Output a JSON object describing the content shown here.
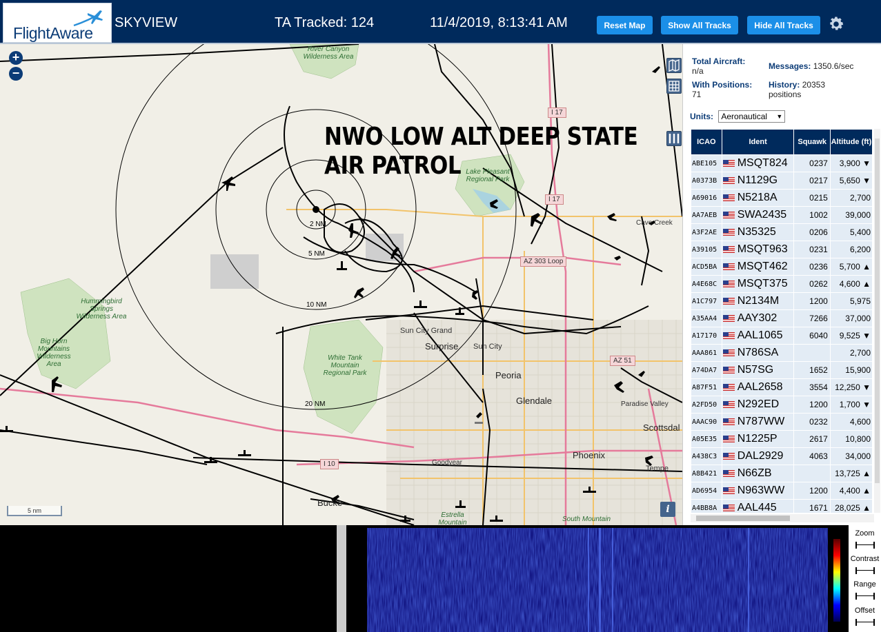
{
  "header": {
    "logo": "FlightAware",
    "app_name": "SKYVIEW",
    "tracked_label": "TA Tracked: 124",
    "datetime": "11/4/2019, 8:13:41 AM",
    "buttons": {
      "reset_map": "Reset Map",
      "show_all_tracks": "Show All Tracks",
      "hide_all_tracks": "Hide All Tracks"
    },
    "settings_icon": "gear-icon"
  },
  "map": {
    "caption_line1": "NWO LOW ALT DEEP STATE",
    "caption_line2": "AIR PATROL",
    "zoom_in": "+",
    "zoom_out": "−",
    "scale_label": "5 nm",
    "info_label": "i",
    "ring_labels": [
      "2 NM",
      "5 NM",
      "10 NM",
      "20 NM"
    ],
    "places": {
      "river_canyon": "River Canyon Wilderness Area",
      "lake_pleasant": "Lake Pleasant Regional Park",
      "hummingbird": "Hummingbird Springs Wilderness Area",
      "big_horn": "Big Horn Mountains Wilderness Area",
      "white_tank": "White Tank Mountain Regional Park",
      "sun_city_grand": "Sun City Grand",
      "surprise": "Surprise",
      "sun_city": "Sun City",
      "peoria": "Peoria",
      "glendale": "Glendale",
      "phoenix": "Phoenix",
      "paradise_valley": "Paradise Valley",
      "scottsdale": "Scottsdal",
      "tempe": "Tempe",
      "goodyear": "Goodyear",
      "buckeye": "Bucke",
      "cave_creek": "Cave Creek",
      "south_mountain": "South Mountain",
      "estrella": "Estrella Mountain"
    },
    "highways": [
      "I 17",
      "I 17",
      "AZ 303 Loop",
      "AZ 51",
      "I 10"
    ]
  },
  "panel": {
    "total_aircraft_label": "Total Aircraft:",
    "total_aircraft_value": "n/a",
    "with_positions_label": "With Positions:",
    "with_positions_value": "71",
    "messages_label": "Messages:",
    "messages_value": "1350.6/sec",
    "history_label": "History:",
    "history_value": "20353 positions",
    "units_label": "Units:",
    "units_value": "Aeronautical",
    "columns": [
      "ICAO",
      "Ident",
      "Squawk",
      "Altitude (ft)"
    ],
    "rows": [
      {
        "icao": "ABE105",
        "ident": "MSQT824",
        "squawk": "0237",
        "alt": "3,900 ▼"
      },
      {
        "icao": "A0373B",
        "ident": "N1129G",
        "squawk": "0217",
        "alt": "5,650 ▼"
      },
      {
        "icao": "A69016",
        "ident": "N5218A",
        "squawk": "0215",
        "alt": "2,700"
      },
      {
        "icao": "AA7AEB",
        "ident": "SWA2435",
        "squawk": "1002",
        "alt": "39,000"
      },
      {
        "icao": "A3F2AE",
        "ident": "N35325",
        "squawk": "0206",
        "alt": "5,400"
      },
      {
        "icao": "A39105",
        "ident": "MSQT963",
        "squawk": "0231",
        "alt": "6,200"
      },
      {
        "icao": "ACD5BA",
        "ident": "MSQT462",
        "squawk": "0236",
        "alt": "5,700 ▲"
      },
      {
        "icao": "A4E68C",
        "ident": "MSQT375",
        "squawk": "0262",
        "alt": "4,600 ▲"
      },
      {
        "icao": "A1C797",
        "ident": "N2134M",
        "squawk": "1200",
        "alt": "5,975"
      },
      {
        "icao": "A35AA4",
        "ident": "AAY302",
        "squawk": "7266",
        "alt": "37,000"
      },
      {
        "icao": "A17170",
        "ident": "AAL1065",
        "squawk": "6040",
        "alt": "9,525 ▼"
      },
      {
        "icao": "AAA861",
        "ident": "N786SA",
        "squawk": "",
        "alt": "2,700"
      },
      {
        "icao": "A74DA7",
        "ident": "N57SG",
        "squawk": "1652",
        "alt": "15,900"
      },
      {
        "icao": "A87F51",
        "ident": "AAL2658",
        "squawk": "3554",
        "alt": "12,250 ▼"
      },
      {
        "icao": "A2FD50",
        "ident": "N292ED",
        "squawk": "1200",
        "alt": "1,700 ▼"
      },
      {
        "icao": "AAAC90",
        "ident": "N787WW",
        "squawk": "0232",
        "alt": "4,600"
      },
      {
        "icao": "A05E35",
        "ident": "N1225P",
        "squawk": "2617",
        "alt": "10,800"
      },
      {
        "icao": "A438C3",
        "ident": "DAL2929",
        "squawk": "4063",
        "alt": "34,000"
      },
      {
        "icao": "A8B421",
        "ident": "N66ZB",
        "squawk": "",
        "alt": "13,725 ▲"
      },
      {
        "icao": "AD6954",
        "ident": "N963WW",
        "squawk": "1200",
        "alt": "4,400 ▲"
      },
      {
        "icao": "A4BB8A",
        "ident": "AAL445",
        "squawk": "1671",
        "alt": "28,025 ▲"
      }
    ]
  },
  "spectrum": {
    "controls": [
      "Zoom",
      "Contrast",
      "Range",
      "Offset"
    ]
  }
}
